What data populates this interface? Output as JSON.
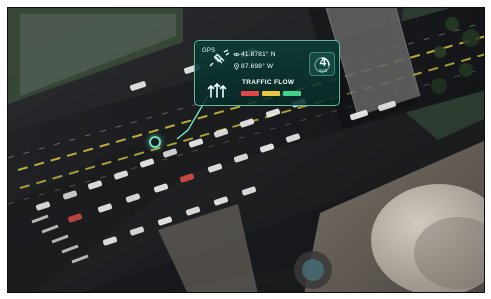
{
  "hud": {
    "gps_label": "GPS",
    "lat": "41.8781° N",
    "lon": "87.698° W",
    "speed": "4",
    "speed_unit": "mph",
    "traffic_flow_title": "TRAFFIC FLOW",
    "traffic_flow_colors": [
      "#e04844",
      "#e7c640",
      "#3fd38a"
    ],
    "accent": "#78ffdc"
  },
  "icons": {
    "gps": "satellite-icon",
    "lanes": "lanes-arrows-icon",
    "coord_lat": "eye-icon",
    "coord_lon": "location-pin-icon",
    "speed": "speed-gauge-icon"
  }
}
